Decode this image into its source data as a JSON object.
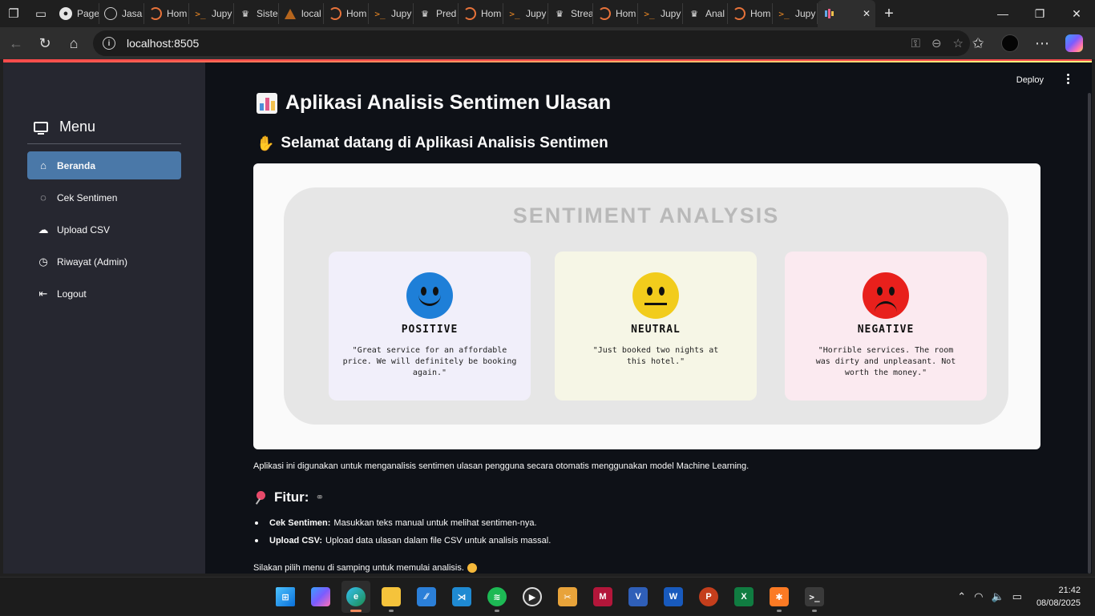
{
  "browser": {
    "tabs": [
      {
        "label": "Page",
        "icon": "github-icon"
      },
      {
        "label": "Jasa",
        "icon": "globe-icon"
      },
      {
        "label": "Hom",
        "icon": "jupyter-icon"
      },
      {
        "label": "Jupy",
        "icon": "terminal-icon"
      },
      {
        "label": "Siste",
        "icon": "streamlit-icon"
      },
      {
        "label": "local",
        "icon": "tri-icon"
      },
      {
        "label": "Hom",
        "icon": "jupyter-icon"
      },
      {
        "label": "Jupy",
        "icon": "terminal-icon"
      },
      {
        "label": "Pred",
        "icon": "streamlit-icon"
      },
      {
        "label": "Hom",
        "icon": "jupyter-icon"
      },
      {
        "label": "Jupy",
        "icon": "terminal-icon"
      },
      {
        "label": "Strea",
        "icon": "streamlit-icon"
      },
      {
        "label": "Hom",
        "icon": "jupyter-icon"
      },
      {
        "label": "Jupy",
        "icon": "terminal-icon"
      },
      {
        "label": "Anal",
        "icon": "streamlit-icon"
      },
      {
        "label": "Hom",
        "icon": "jupyter-icon"
      },
      {
        "label": "Jupy",
        "icon": "terminal-icon"
      }
    ],
    "active_tab_icon": "bar-chart-icon",
    "close_glyph": "✕",
    "new_tab_glyph": "+",
    "url": "localhost:8505"
  },
  "app": {
    "deploy_label": "Deploy",
    "sidebar": {
      "heading": "Menu",
      "items": [
        {
          "label": "Beranda",
          "icon": "home-icon",
          "active": true
        },
        {
          "label": "Cek Sentimen",
          "icon": "chat-bubble-icon",
          "active": false
        },
        {
          "label": "Upload CSV",
          "icon": "cloud-upload-icon",
          "active": false
        },
        {
          "label": "Riwayat (Admin)",
          "icon": "clock-icon",
          "active": false
        },
        {
          "label": "Logout",
          "icon": "logout-icon",
          "active": false
        }
      ]
    },
    "title": "Aplikasi Analisis Sentimen Ulasan",
    "welcome": "Selamat datang di Aplikasi Analisis Sentimen",
    "hero": {
      "heading": "SENTIMENT  ANALYSIS",
      "cards": [
        {
          "label": "POSITIVE",
          "quote": "\"Great service for an affordable price. We will definitely be booking again.\""
        },
        {
          "label": "NEUTRAL",
          "quote": "\"Just booked two nights at this hotel.\""
        },
        {
          "label": "NEGATIVE",
          "quote": "\"Horrible services. The room was dirty and unpleasant. Not worth the money.\""
        }
      ]
    },
    "description": "Aplikasi ini digunakan untuk menganalisis sentimen ulasan pengguna secara otomatis menggunakan model Machine Learning.",
    "features_heading": "Fitur:",
    "features": [
      {
        "name": "Cek Sentimen:",
        "text": "Masukkan teks manual untuk melihat sentimen-nya."
      },
      {
        "name": "Upload CSV:",
        "text": "Upload data ulasan dalam file CSV untuk analisis massal."
      }
    ],
    "closing": "Silakan pilih menu di samping untuk memulai analisis."
  },
  "taskbar": {
    "apps": [
      "start-icon",
      "copilot-icon",
      "edge-icon",
      "file-explorer-icon",
      "vscode-alt-icon",
      "vscode-icon",
      "spotify-icon",
      "media-player-icon",
      "snipping-icon",
      "mendeley-icon",
      "visio-icon",
      "word-icon",
      "powerpoint-icon",
      "excel-icon",
      "xampp-icon",
      "terminal-icon"
    ],
    "time": "21:42",
    "date": "08/08/2025"
  }
}
